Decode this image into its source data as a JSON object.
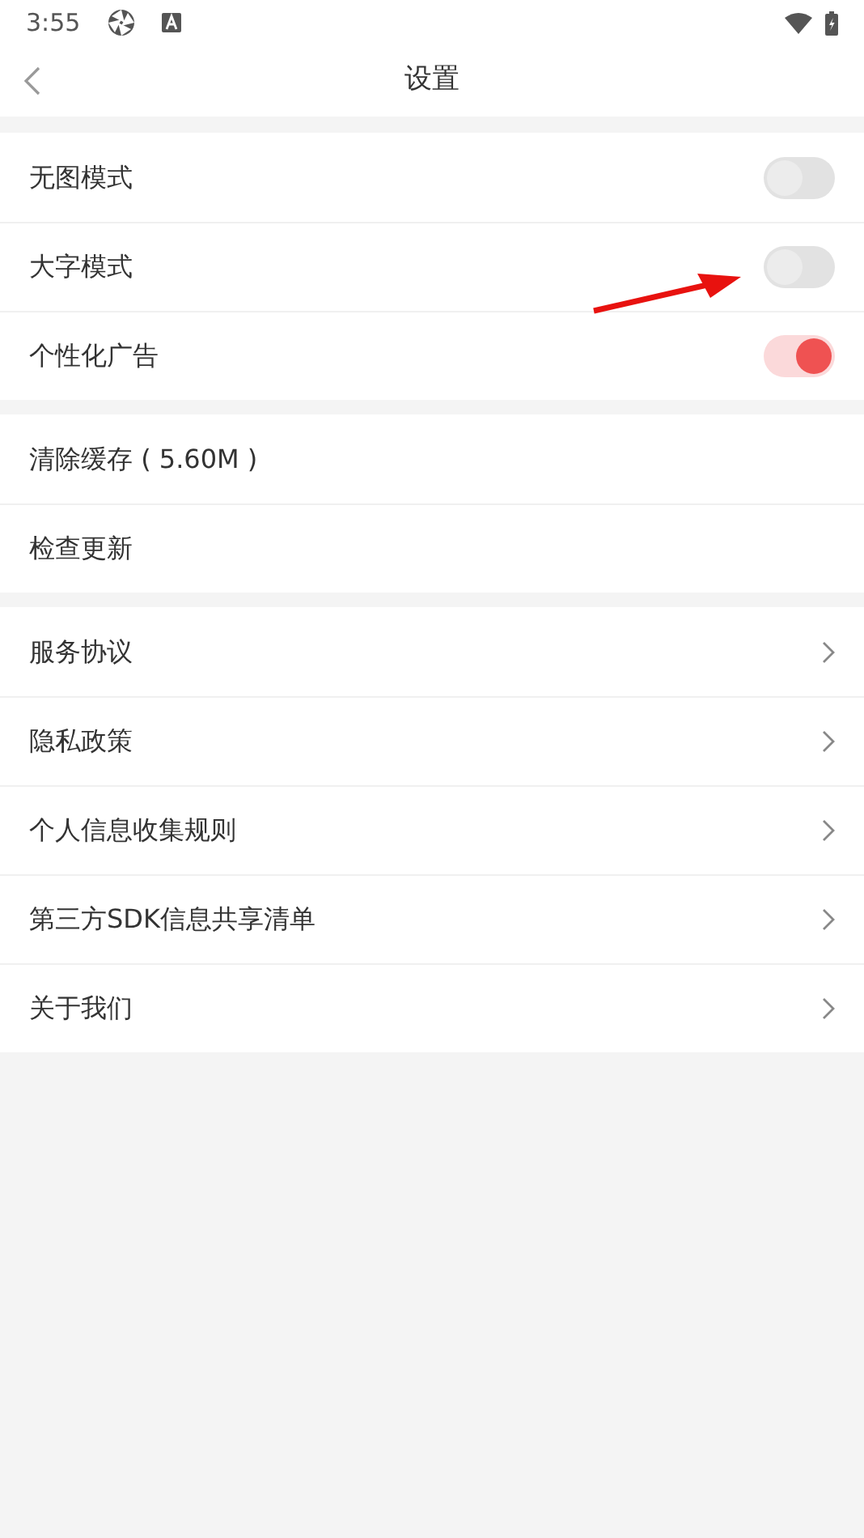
{
  "status_bar": {
    "time": "3:55"
  },
  "header": {
    "title": "设置"
  },
  "groups": [
    {
      "items": [
        {
          "kind": "toggle",
          "label": "无图模式",
          "on": false
        },
        {
          "kind": "toggle",
          "label": "大字模式",
          "on": false
        },
        {
          "kind": "toggle",
          "label": "个性化广告",
          "on": true
        }
      ]
    },
    {
      "items": [
        {
          "kind": "plain",
          "label": "清除缓存 ( 5.60M )"
        },
        {
          "kind": "plain",
          "label": "检查更新"
        }
      ]
    },
    {
      "items": [
        {
          "kind": "link",
          "label": "服务协议"
        },
        {
          "kind": "link",
          "label": "隐私政策"
        },
        {
          "kind": "link",
          "label": "个人信息收集规则"
        },
        {
          "kind": "link",
          "label": "第三方SDK信息共享清单"
        },
        {
          "kind": "link",
          "label": "关于我们"
        }
      ]
    }
  ]
}
